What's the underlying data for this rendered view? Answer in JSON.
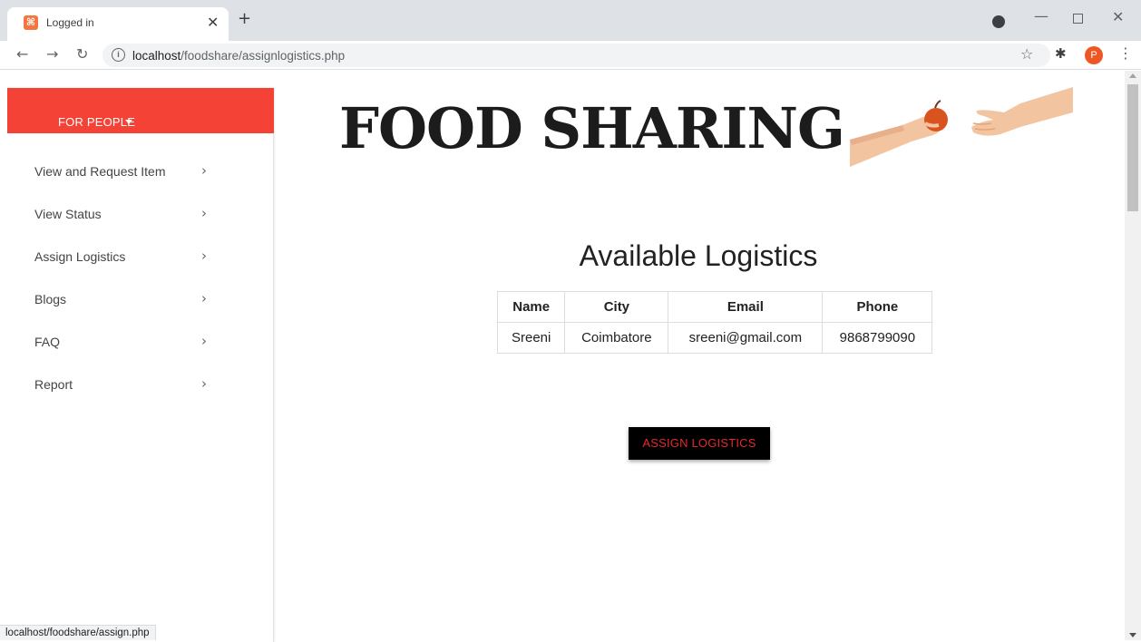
{
  "browser": {
    "tab_title": "Logged in",
    "favicon_glyph": "⌘",
    "url_host": "localhost",
    "url_path": "/foodshare/assignlogistics.php",
    "profile_initial": "P",
    "status_url": "localhost/foodshare/assign.php"
  },
  "sidebar": {
    "header": "FOR PEOPLE",
    "items": [
      {
        "label": "View and Request Item"
      },
      {
        "label": "View Status"
      },
      {
        "label": "Assign Logistics"
      },
      {
        "label": "Blogs"
      },
      {
        "label": "FAQ"
      },
      {
        "label": "Report"
      }
    ]
  },
  "brand": {
    "title": "FOOD SHARING"
  },
  "main": {
    "section_title": "Available Logistics",
    "table": {
      "headers": [
        "Name",
        "City",
        "Email",
        "Phone"
      ],
      "rows": [
        [
          "Sreeni",
          "Coimbatore",
          "sreeni@gmail.com",
          "9868799090"
        ]
      ]
    },
    "assign_button": "ASSIGN LOGISTICS"
  },
  "colors": {
    "sidebar_header": "#f44336",
    "button_bg": "#000000",
    "button_text": "#e52a2a"
  }
}
